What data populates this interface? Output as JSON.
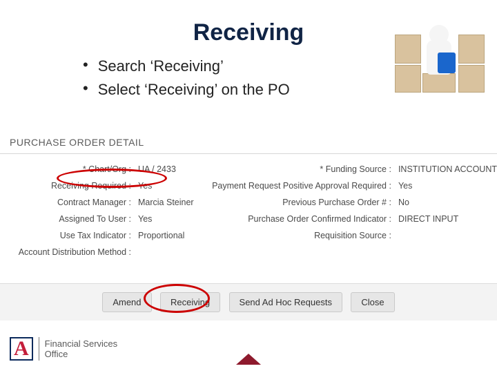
{
  "title": "Receiving",
  "bullets": [
    "Search ‘Receiving’",
    "Select ‘Receiving’ on the PO"
  ],
  "panel": {
    "heading": "PURCHASE ORDER DETAIL",
    "left": {
      "labels": [
        "* Chart/Org :",
        "Receiving Required :",
        "Contract Manager :",
        "Assigned To User :",
        "Use Tax Indicator :",
        "Account Distribution Method :"
      ],
      "values": [
        "UA / 2433",
        "Yes",
        "Marcia Steiner",
        "",
        "Yes",
        "Proportional"
      ]
    },
    "right": {
      "labels": [
        "* Funding Source :",
        "Payment Request Positive Approval Required :",
        "Previous Purchase Order # :",
        "Purchase Order Confirmed Indicator :",
        "Requisition Source :"
      ],
      "values": [
        "INSTITUTION ACCOUNT",
        "Yes",
        "",
        "No",
        "DIRECT INPUT"
      ]
    }
  },
  "buttons": {
    "amend": "Amend",
    "receiving": "Receiving",
    "sendadhoc": "Send Ad Hoc Requests",
    "close": "Close"
  },
  "footer": {
    "letter": "A",
    "line1": "Financial Services",
    "line2": "Office"
  }
}
